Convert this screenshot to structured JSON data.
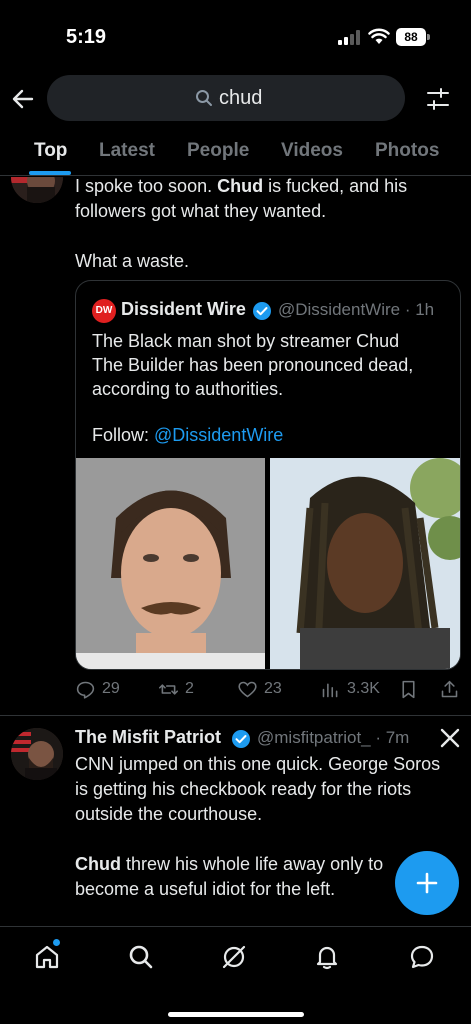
{
  "status_bar": {
    "time": "5:19",
    "battery": "88"
  },
  "search": {
    "query": "chud"
  },
  "tabs": [
    {
      "label": "Top",
      "active": true
    },
    {
      "label": "Latest",
      "active": false
    },
    {
      "label": "People",
      "active": false
    },
    {
      "label": "Videos",
      "active": false
    },
    {
      "label": "Photos",
      "active": false
    }
  ],
  "post1": {
    "line1_pre": "I spoke too soon. ",
    "line1_bold": "Chud",
    "line1_post": " is fucked, and his",
    "line2": "followers got what they wanted.",
    "line3": "What a waste.",
    "quote": {
      "logo_text": "DW",
      "name": "Dissident Wire",
      "handle_time": "@DissidentWire · 1h",
      "body_lines": [
        "The Black man shot by streamer Chud",
        "The Builder has been pronounced dead,",
        "according to authorities."
      ],
      "follow_label": "Follow: ",
      "follow_link": "@DissidentWire"
    },
    "stats": {
      "replies": "29",
      "reposts": "2",
      "likes": "23",
      "views": "3.3K"
    }
  },
  "post2": {
    "name": "The Misfit Patriot",
    "handle_time": "@misfitpatriot_ · 7m",
    "lines": [
      "CNN jumped on this one quick. George Soros",
      "is getting his checkbook ready for the riots",
      "outside the courthouse."
    ],
    "line4_bold": "Chud",
    "line4_post": " threw his whole life away only to",
    "line5": "become a useful idiot for the left."
  },
  "icons": {
    "back": "arrow-left-icon",
    "search": "search-icon",
    "filters": "sliders-icon",
    "grok": "grok-x-icon",
    "compose": "plus-icon",
    "nav": [
      "home-icon",
      "search-icon",
      "grok-icon",
      "bell-icon",
      "messages-icon"
    ]
  },
  "colors": {
    "accent": "#1d9bf0",
    "background": "#000000",
    "muted": "#71767b",
    "text": "#e7e9ea"
  }
}
